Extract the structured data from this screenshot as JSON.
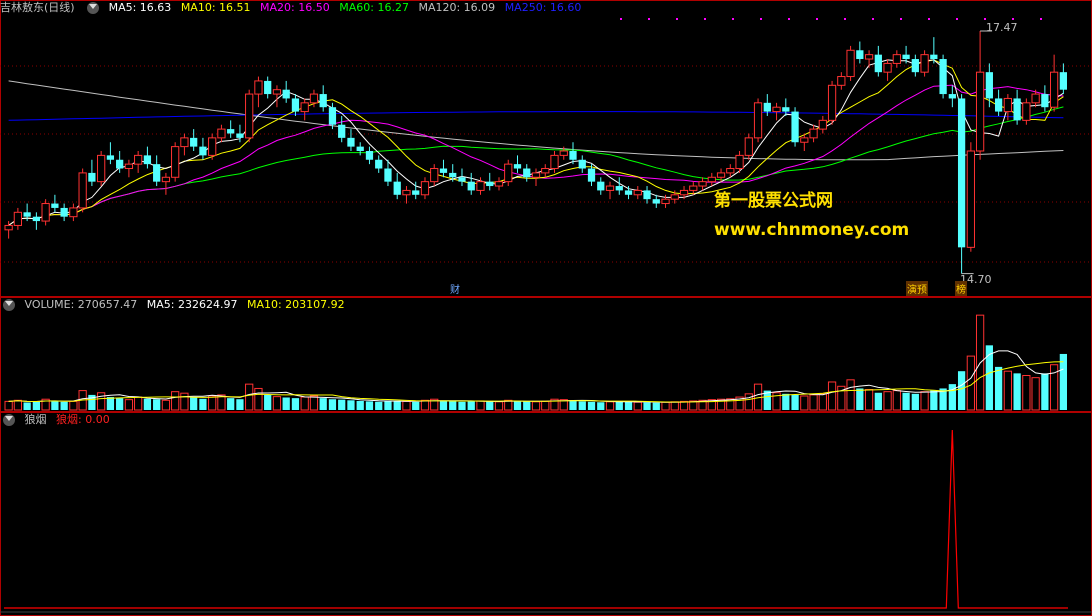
{
  "colors": {
    "ma5": "#ffffff",
    "ma10": "#ffff00",
    "ma20": "#ff00ff",
    "ma60": "#00ff00",
    "ma120": "#c0c0c0",
    "ma250": "#0000ff",
    "up": "#ff3232",
    "down": "#54ffff",
    "grid": "#8b0000",
    "border": "#b00000",
    "signal": "#ff0000",
    "watermark": "#ffe000"
  },
  "main": {
    "title": "吉林敖东(日线)",
    "ma5_label": "MA5: 16.63",
    "ma10_label": "MA10: 16.51",
    "ma20_label": "MA20: 16.50",
    "ma60_label": "MA60: 16.27",
    "ma120_label": "MA120: 16.09",
    "ma250_label": "MA250: 16.60",
    "high_label": "17.47",
    "low_label": "14.70",
    "marker_cai": "财",
    "marker_yanyu": "演预",
    "marker_bang": "榜",
    "watermark_cn": "第一股票公式网",
    "watermark_url": "www.chnmoney.com"
  },
  "volume": {
    "volume_label": "VOLUME: 270657.47",
    "ma5_label": "MA5: 232624.97",
    "ma10_label": "MA10: 203107.92"
  },
  "indicator": {
    "name": "狼烟",
    "value_label": "狼烟: 0.00"
  },
  "chart_data": {
    "type": "candlestick",
    "price_high": 17.47,
    "price_low": 14.7,
    "candles": [
      [
        15.2,
        15.3,
        15.1,
        15.25
      ],
      [
        15.25,
        15.45,
        15.2,
        15.4
      ],
      [
        15.4,
        15.5,
        15.3,
        15.35
      ],
      [
        15.35,
        15.4,
        15.2,
        15.3
      ],
      [
        15.3,
        15.55,
        15.25,
        15.5
      ],
      [
        15.5,
        15.6,
        15.4,
        15.45
      ],
      [
        15.45,
        15.5,
        15.3,
        15.35
      ],
      [
        15.35,
        15.5,
        15.3,
        15.45
      ],
      [
        15.45,
        15.9,
        15.4,
        15.85
      ],
      [
        15.85,
        16.0,
        15.7,
        15.75
      ],
      [
        15.75,
        16.1,
        15.7,
        16.05
      ],
      [
        16.05,
        16.2,
        15.95,
        16.0
      ],
      [
        16.0,
        16.1,
        15.85,
        15.9
      ],
      [
        15.9,
        16.0,
        15.8,
        15.95
      ],
      [
        15.95,
        16.1,
        15.85,
        16.05
      ],
      [
        16.05,
        16.15,
        15.9,
        15.95
      ],
      [
        15.95,
        16.05,
        15.7,
        15.75
      ],
      [
        15.75,
        15.85,
        15.6,
        15.8
      ],
      [
        15.8,
        16.2,
        15.75,
        16.15
      ],
      [
        16.15,
        16.3,
        16.05,
        16.25
      ],
      [
        16.25,
        16.35,
        16.1,
        16.15
      ],
      [
        16.15,
        16.25,
        16.0,
        16.05
      ],
      [
        16.05,
        16.3,
        16.0,
        16.25
      ],
      [
        16.25,
        16.4,
        16.2,
        16.35
      ],
      [
        16.35,
        16.45,
        16.25,
        16.3
      ],
      [
        16.3,
        16.4,
        16.2,
        16.25
      ],
      [
        16.25,
        16.8,
        16.2,
        16.75
      ],
      [
        16.75,
        16.95,
        16.6,
        16.9
      ],
      [
        16.9,
        16.95,
        16.7,
        16.75
      ],
      [
        16.75,
        16.85,
        16.6,
        16.8
      ],
      [
        16.8,
        16.9,
        16.65,
        16.7
      ],
      [
        16.7,
        16.75,
        16.5,
        16.55
      ],
      [
        16.55,
        16.7,
        16.45,
        16.65
      ],
      [
        16.65,
        16.8,
        16.6,
        16.75
      ],
      [
        16.75,
        16.85,
        16.55,
        16.6
      ],
      [
        16.6,
        16.65,
        16.35,
        16.4
      ],
      [
        16.4,
        16.5,
        16.2,
        16.25
      ],
      [
        16.25,
        16.35,
        16.1,
        16.15
      ],
      [
        16.15,
        16.2,
        16.05,
        16.1
      ],
      [
        16.1,
        16.15,
        15.95,
        16.0
      ],
      [
        16.0,
        16.05,
        15.85,
        15.9
      ],
      [
        15.9,
        16.0,
        15.7,
        15.75
      ],
      [
        15.75,
        15.85,
        15.55,
        15.6
      ],
      [
        15.6,
        15.7,
        15.5,
        15.65
      ],
      [
        15.65,
        15.75,
        15.55,
        15.6
      ],
      [
        15.6,
        15.8,
        15.55,
        15.75
      ],
      [
        15.75,
        15.95,
        15.7,
        15.9
      ],
      [
        15.9,
        16.0,
        15.8,
        15.85
      ],
      [
        15.85,
        15.95,
        15.75,
        15.8
      ],
      [
        15.8,
        15.9,
        15.7,
        15.75
      ],
      [
        15.75,
        15.85,
        15.6,
        15.65
      ],
      [
        15.65,
        15.8,
        15.6,
        15.75
      ],
      [
        15.75,
        15.85,
        15.65,
        15.7
      ],
      [
        15.7,
        15.8,
        15.65,
        15.75
      ],
      [
        15.75,
        16.0,
        15.7,
        15.95
      ],
      [
        15.95,
        16.05,
        15.85,
        15.9
      ],
      [
        15.9,
        15.95,
        15.75,
        15.8
      ],
      [
        15.8,
        15.9,
        15.7,
        15.85
      ],
      [
        15.85,
        15.95,
        15.8,
        15.9
      ],
      [
        15.9,
        16.1,
        15.85,
        16.05
      ],
      [
        16.05,
        16.15,
        16.0,
        16.1
      ],
      [
        16.1,
        16.2,
        15.95,
        16.0
      ],
      [
        16.0,
        16.05,
        15.85,
        15.9
      ],
      [
        15.9,
        15.95,
        15.7,
        15.75
      ],
      [
        15.75,
        15.8,
        15.6,
        15.65
      ],
      [
        15.65,
        15.75,
        15.55,
        15.7
      ],
      [
        15.7,
        15.8,
        15.6,
        15.65
      ],
      [
        15.65,
        15.7,
        15.55,
        15.6
      ],
      [
        15.6,
        15.7,
        15.55,
        15.65
      ],
      [
        15.65,
        15.7,
        15.5,
        15.55
      ],
      [
        15.55,
        15.6,
        15.45,
        15.5
      ],
      [
        15.5,
        15.6,
        15.45,
        15.55
      ],
      [
        15.55,
        15.65,
        15.5,
        15.6
      ],
      [
        15.6,
        15.7,
        15.55,
        15.65
      ],
      [
        15.65,
        15.75,
        15.6,
        15.7
      ],
      [
        15.7,
        15.8,
        15.65,
        15.75
      ],
      [
        15.75,
        15.85,
        15.7,
        15.8
      ],
      [
        15.8,
        15.9,
        15.75,
        15.85
      ],
      [
        15.85,
        15.95,
        15.8,
        15.9
      ],
      [
        15.9,
        16.1,
        15.85,
        16.05
      ],
      [
        16.05,
        16.3,
        16.0,
        16.25
      ],
      [
        16.25,
        16.7,
        16.2,
        16.65
      ],
      [
        16.65,
        16.75,
        16.5,
        16.55
      ],
      [
        16.55,
        16.65,
        16.45,
        16.6
      ],
      [
        16.6,
        16.7,
        16.5,
        16.55
      ],
      [
        16.55,
        16.6,
        16.15,
        16.2
      ],
      [
        16.2,
        16.3,
        16.1,
        16.25
      ],
      [
        16.25,
        16.4,
        16.2,
        16.35
      ],
      [
        16.35,
        16.5,
        16.3,
        16.45
      ],
      [
        16.45,
        16.9,
        16.4,
        16.85
      ],
      [
        16.85,
        17.0,
        16.8,
        16.95
      ],
      [
        16.95,
        17.3,
        16.9,
        17.25
      ],
      [
        17.25,
        17.35,
        17.1,
        17.15
      ],
      [
        17.15,
        17.25,
        17.05,
        17.2
      ],
      [
        17.2,
        17.3,
        16.95,
        17.0
      ],
      [
        17.0,
        17.15,
        16.9,
        17.1
      ],
      [
        17.1,
        17.25,
        17.05,
        17.2
      ],
      [
        17.2,
        17.3,
        17.1,
        17.15
      ],
      [
        17.15,
        17.2,
        16.95,
        17.0
      ],
      [
        17.0,
        17.25,
        16.95,
        17.2
      ],
      [
        17.2,
        17.4,
        17.1,
        17.15
      ],
      [
        17.15,
        17.2,
        16.7,
        16.75
      ],
      [
        16.75,
        16.85,
        16.6,
        16.7
      ],
      [
        16.7,
        16.75,
        14.7,
        15.0
      ],
      [
        15.0,
        16.2,
        14.95,
        16.1
      ],
      [
        16.1,
        17.47,
        16.0,
        17.0
      ],
      [
        17.0,
        17.1,
        16.6,
        16.7
      ],
      [
        16.7,
        16.8,
        16.5,
        16.55
      ],
      [
        16.55,
        16.75,
        16.45,
        16.7
      ],
      [
        16.7,
        16.8,
        16.4,
        16.45
      ],
      [
        16.45,
        16.7,
        16.4,
        16.65
      ],
      [
        16.65,
        16.8,
        16.6,
        16.75
      ],
      [
        16.75,
        16.85,
        16.55,
        16.6
      ],
      [
        16.6,
        17.2,
        16.55,
        17.0
      ],
      [
        17.0,
        17.1,
        16.75,
        16.8
      ]
    ],
    "volume_ymax": 450000,
    "volumes": [
      40,
      45,
      35,
      38,
      50,
      42,
      38,
      40,
      90,
      70,
      80,
      60,
      55,
      48,
      60,
      52,
      50,
      45,
      85,
      78,
      60,
      52,
      65,
      70,
      55,
      50,
      120,
      100,
      70,
      62,
      58,
      55,
      60,
      65,
      55,
      50,
      48,
      45,
      42,
      40,
      38,
      44,
      42,
      40,
      38,
      45,
      50,
      42,
      40,
      38,
      40,
      42,
      40,
      38,
      45,
      42,
      40,
      38,
      40,
      50,
      48,
      45,
      40,
      38,
      36,
      38,
      40,
      38,
      36,
      35,
      34,
      36,
      38,
      40,
      42,
      45,
      48,
      50,
      52,
      60,
      75,
      120,
      90,
      80,
      75,
      70,
      65,
      70,
      75,
      130,
      110,
      140,
      100,
      95,
      80,
      85,
      90,
      80,
      75,
      85,
      90,
      100,
      120,
      180,
      250,
      440,
      300,
      200,
      180,
      170,
      160,
      150,
      170,
      210,
      260
    ],
    "indicator_ymax": 1,
    "indicator_spike_index": 102
  }
}
